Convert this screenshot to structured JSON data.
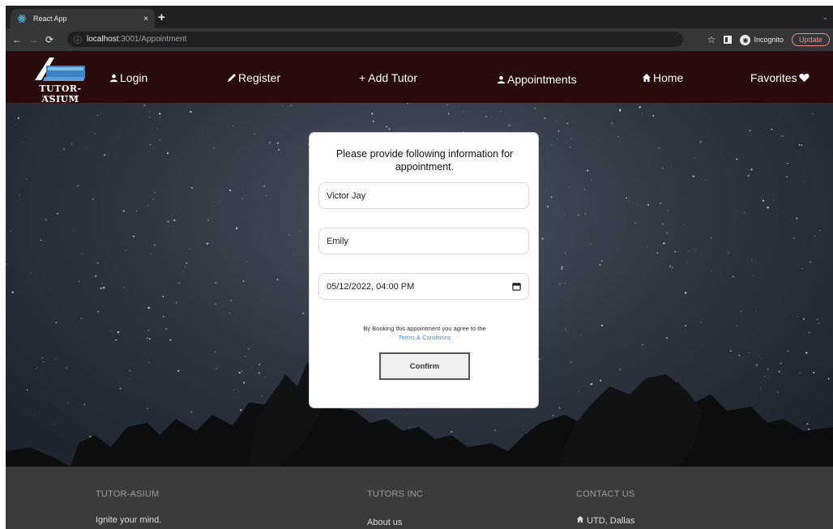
{
  "browser": {
    "tab_title": "React App",
    "tab_close": "×",
    "new_tab": "+",
    "tab_search": "⌄",
    "url_host": "localhost",
    "url_path": ":3001/Appointment",
    "incognito_label": "Incognito",
    "update_label": "Update"
  },
  "site_nav": {
    "logo_name": "TUTOR-ASIUM",
    "logo_tagline": "IGNITE YOUR MIND",
    "items": [
      {
        "label": "Login",
        "icon": "user-icon"
      },
      {
        "label": "Register",
        "icon": "pencil-icon"
      },
      {
        "label": "+ Add Tutor",
        "icon": ""
      },
      {
        "label": "Appointments",
        "icon": "user-icon"
      },
      {
        "label": "Home",
        "icon": "home-icon"
      },
      {
        "label": "Favorites",
        "icon": "heart-icon"
      }
    ]
  },
  "appointment_form": {
    "heading": "Please provide following information for appointment.",
    "student_name_value": "Victor Jay",
    "tutor_name_value": "Emily",
    "datetime_value": "05/12/2022, 04:00 PM",
    "terms_text": "By Booking this appointment you agree to the",
    "terms_link": "Terms & Conditions",
    "confirm_label": "Confirm"
  },
  "footer": {
    "columns": [
      {
        "heading": "TUTOR-ASIUM",
        "text": "Ignite your mind."
      },
      {
        "heading": "TUTORS INC",
        "text": "About us"
      },
      {
        "heading": "CONTACT US",
        "text": "UTD, Dallas"
      }
    ]
  },
  "colors": {
    "nav_background": "#2a0b0b",
    "footer_background": "#3b3b3b",
    "link_blue": "#4a90d9",
    "update_accent": "#f28b82"
  }
}
